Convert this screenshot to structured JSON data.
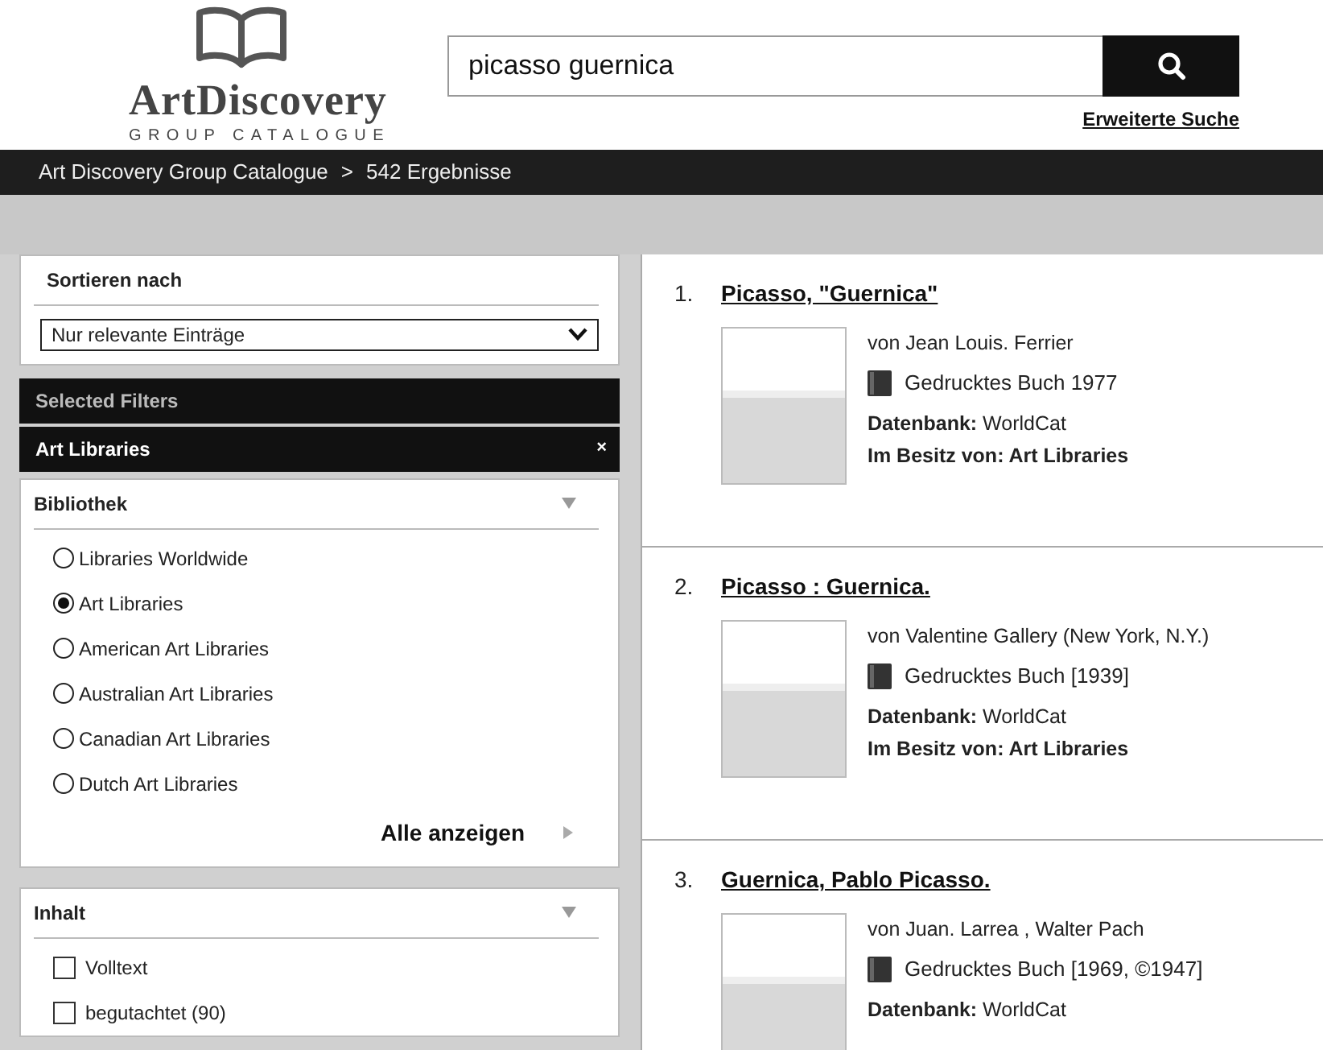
{
  "logo": {
    "title": "ArtDiscovery",
    "subtitle": "GROUP CATALOGUE"
  },
  "search": {
    "value": "picasso guernica",
    "advanced_link": "Erweiterte Suche"
  },
  "breadcrumb": {
    "items": [
      "Art Discovery Group Catalogue",
      "542 Ergebnisse"
    ],
    "separator": ">"
  },
  "sort": {
    "title": "Sortieren nach",
    "value": "Nur relevante Einträge"
  },
  "selected_filters": {
    "title": "Selected Filters",
    "items": [
      {
        "label": "Art Libraries",
        "remove": "×"
      }
    ]
  },
  "facets": [
    {
      "title": "Bibliothek",
      "kind": "radio",
      "options": [
        {
          "label": "Libraries Worldwide",
          "selected": false
        },
        {
          "label": "Art Libraries",
          "selected": true
        },
        {
          "label": "American Art Libraries",
          "selected": false
        },
        {
          "label": "Australian Art Libraries",
          "selected": false
        },
        {
          "label": "Canadian Art Libraries",
          "selected": false
        },
        {
          "label": "Dutch Art Libraries",
          "selected": false
        }
      ],
      "more": "Alle anzeigen"
    },
    {
      "title": "Inhalt",
      "kind": "checkbox",
      "options": [
        {
          "label": "Volltext",
          "checked": false
        },
        {
          "label": "begutachtet (90)",
          "checked": false
        }
      ]
    }
  ],
  "results": [
    {
      "number": "1.",
      "title": "Picasso, \"Guernica\"",
      "author": "von Jean Louis. Ferrier",
      "format": "Gedrucktes Buch 1977",
      "database": "**Datenbank:** WorldCat",
      "holdings": "Im Besitz von: Art Libraries"
    },
    {
      "number": "2.",
      "title": "Picasso : Guernica.",
      "author": "von Valentine Gallery (New York, N.Y.)",
      "format": "Gedrucktes Buch [1939]",
      "database": "**Datenbank:** WorldCat",
      "holdings": "Im Besitz von: Art Libraries"
    },
    {
      "number": "3.",
      "title": "Guernica, Pablo Picasso.",
      "author": "von Juan. Larrea , Walter Pach",
      "format": "Gedrucktes Buch [1969, ©1947]",
      "database": "**Datenbank:** WorldCat"
    }
  ]
}
